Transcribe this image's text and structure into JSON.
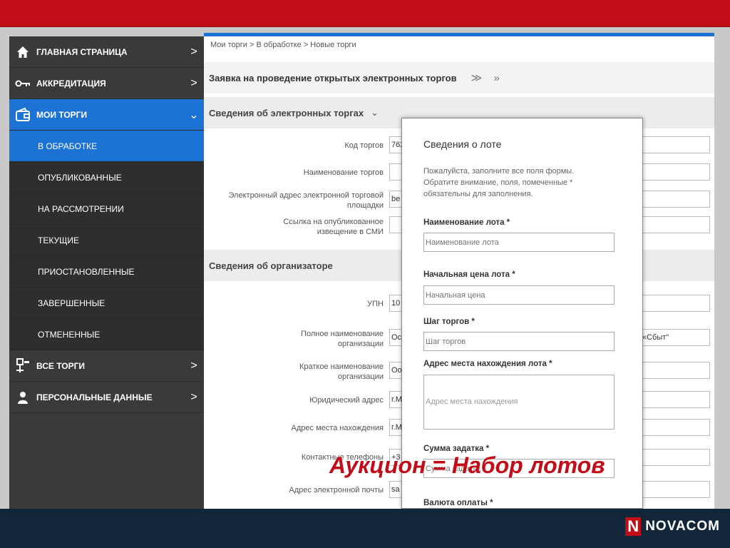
{
  "brand": {
    "logo_letter": "N",
    "logo_text": "NOVACOM"
  },
  "caption": "Аукцион = Набор лотов",
  "sidebar": {
    "items": [
      {
        "label": "ГЛАВНАЯ СТРАНИЦА",
        "icon": "home-icon"
      },
      {
        "label": "АККРЕДИТАЦИЯ",
        "icon": "key-icon"
      },
      {
        "label": "МОИ ТОРГИ",
        "icon": "wallet-icon"
      },
      {
        "label": "ВСЕ ТОРГИ",
        "icon": "hierarchy-icon"
      },
      {
        "label": "ПЕРСОНАЛЬНЫЕ ДАННЫЕ",
        "icon": "user-icon"
      }
    ],
    "subitems": [
      "В ОБРАБОТКЕ",
      "ОПУБЛИКОВАННЫЕ",
      "НА РАССМОТРЕНИИ",
      "ТЕКУЩИЕ",
      "ПРИОСТАНОВЛЕННЫЕ",
      "ЗАВЕРШЕННЫЕ",
      "ОТМЕНЕННЫЕ"
    ],
    "chevron_right": ">",
    "chevron_down": "⌄"
  },
  "breadcrumb": "Мои торги  >  В обработке >  Новые торги",
  "page_title": "Заявка на проведение открытых электронных торгов",
  "title_actions": "≫ »",
  "section1": {
    "title": "Сведения об электронных торгах",
    "fields": [
      {
        "label": "Код торгов",
        "value": "762"
      },
      {
        "label": "Наименование торгов",
        "value": ""
      },
      {
        "label": "Электронный адрес электронной торговой площадки",
        "value": "be"
      },
      {
        "label": "Ссылка на опубликованное извещение в СМИ",
        "value": ""
      }
    ]
  },
  "section2": {
    "title": "Сведения об организаторе",
    "fields": [
      {
        "label": "УПН",
        "value": "10"
      },
      {
        "label": "Полное наименование организации",
        "value": "Ос",
        "value_right": "«Сбыт\""
      },
      {
        "label": "Краткое наименование организации",
        "value": "Оо"
      },
      {
        "label": "Юридический адрес",
        "value": "г.М"
      },
      {
        "label": "Адрес места нахождения",
        "value": "г.М"
      },
      {
        "label": "Контактные телефоны",
        "value": "+3"
      },
      {
        "label": "Адрес электронной почты",
        "value": "sa"
      }
    ]
  },
  "modal": {
    "title": "Сведения о лоте",
    "note": "Пожалуйста, заполните все поля формы. Обратите внимание, поля, помеченные * обязательны для заполнения.",
    "fields": [
      {
        "label": "Наименование лота *",
        "placeholder": "Наименование лота"
      },
      {
        "label": "Начальная цена лота *",
        "placeholder": "Начальная цена"
      },
      {
        "label": "Шаг торгов *",
        "placeholder": "Шаг торгов"
      },
      {
        "label": "Адрес места нахождения лота *",
        "placeholder": "Адрес места нахождения"
      },
      {
        "label": "Сумма задатка *",
        "placeholder": "Сумма задатка"
      },
      {
        "label": "Валюта оплаты *",
        "placeholder": ""
      }
    ]
  }
}
